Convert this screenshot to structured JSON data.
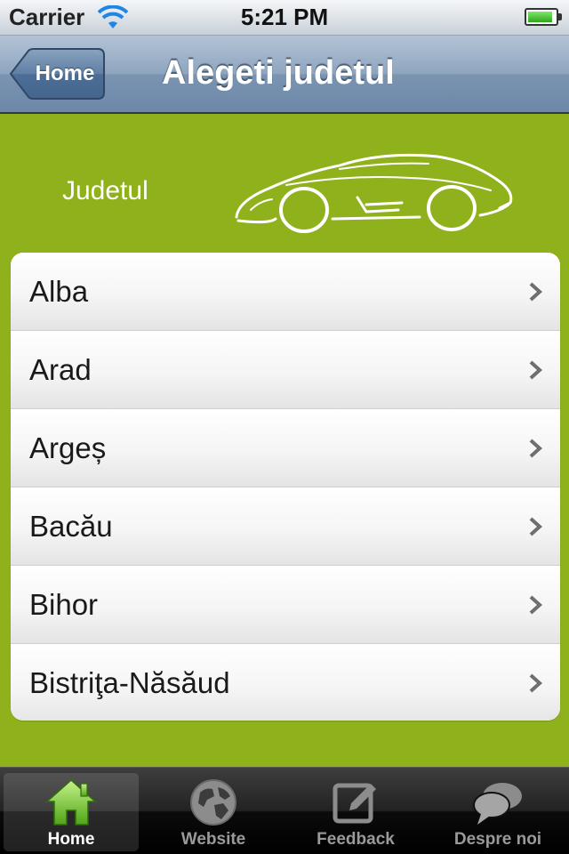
{
  "status_bar": {
    "carrier": "Carrier",
    "time": "5:21 PM",
    "battery_level": 0.9,
    "battery_color": "#2fa41c"
  },
  "nav_bar": {
    "back_label": "Home",
    "title": "Alegeti judetul",
    "tint": "#6d88a8"
  },
  "banner": {
    "label": "Judetul",
    "image_icon": "car-sketch"
  },
  "list": {
    "items": [
      {
        "label": "Alba"
      },
      {
        "label": "Arad"
      },
      {
        "label": "Argeș"
      },
      {
        "label": "Bacău"
      },
      {
        "label": "Bihor"
      },
      {
        "label": "Bistriţa-Năsăud"
      }
    ],
    "accessory_icon": "chevron-right"
  },
  "tab_bar": {
    "selected": "Home",
    "tabs": [
      {
        "label": "Home",
        "icon": "house-icon"
      },
      {
        "label": "Website",
        "icon": "globe-icon"
      },
      {
        "label": "Feedback",
        "icon": "pencil-square-icon"
      },
      {
        "label": "Despre noi",
        "icon": "speech-bubbles-icon"
      }
    ]
  },
  "colors": {
    "background": "#8fb11c",
    "house_green": "#7fd23a"
  }
}
